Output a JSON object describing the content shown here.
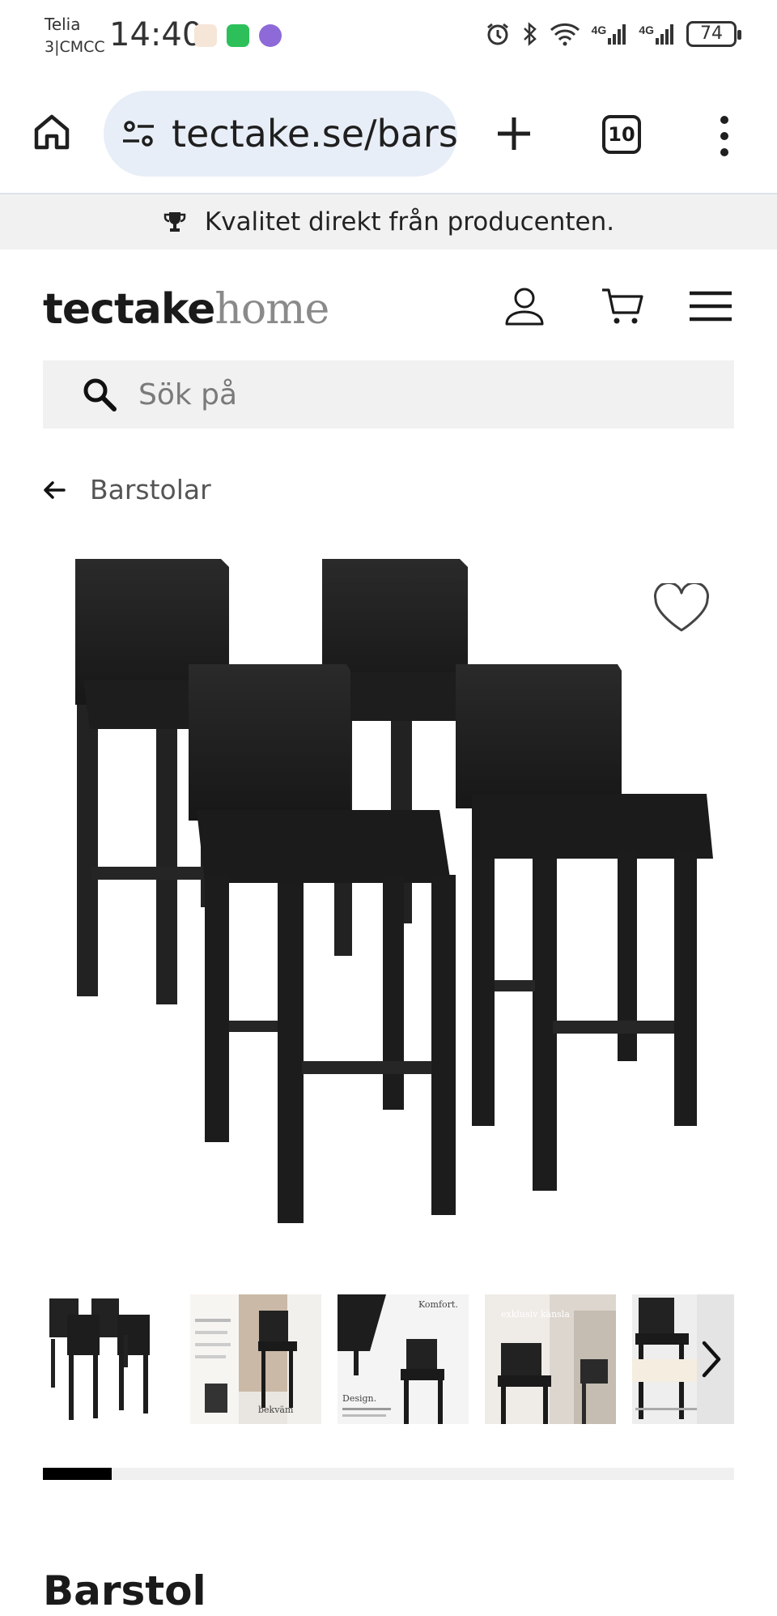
{
  "status_bar": {
    "carrier_line1": "Telia",
    "carrier_line2": "3|CMCC",
    "time": "14:40",
    "battery": "74",
    "network_1": "4G",
    "network_2": "4G"
  },
  "browser": {
    "url": "tectake.se/barstolar",
    "tab_count": "10"
  },
  "promo": {
    "text": "Kvalitet direkt från producenten."
  },
  "header": {
    "logo_brand": "tectake",
    "logo_sub": "home"
  },
  "search": {
    "placeholder": "Sök på"
  },
  "breadcrumb": {
    "label": "Barstolar"
  },
  "gallery": {
    "thumbnail_captions": [
      "Komfort.",
      "Design.",
      "exklusiv känsla",
      "bekväm"
    ],
    "progress": 0.1
  },
  "product": {
    "title": "Barstol"
  },
  "colors": {
    "accent": "#000000",
    "url_pill": "#e8eef7",
    "promo_bg": "#f1f1f1",
    "chair": "#1e1e1e"
  }
}
